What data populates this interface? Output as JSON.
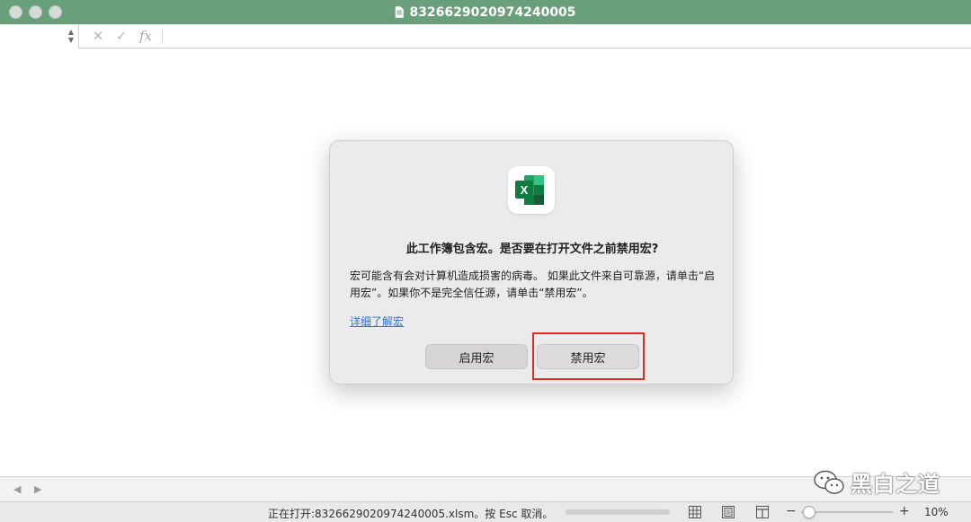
{
  "window": {
    "title": "8326629020974240005"
  },
  "colors": {
    "titlebar": "#69a07b",
    "excel_green": "#1d6f42",
    "link": "#2d6fd6",
    "highlight": "#e02a2a"
  },
  "formula_bar": {
    "name_box_value": "",
    "fx_label": "fx",
    "cancel_icon": "x-icon",
    "confirm_icon": "check-icon"
  },
  "dialog": {
    "app_icon_letter": "X",
    "title": "此工作簿包含宏。是否要在打开文件之前禁用宏?",
    "body": "宏可能含有会对计算机造成损害的病毒。 如果此文件来自可靠源，请单击“启用宏”。如果你不是完全信任源，请单击“禁用宏”。",
    "learn_more": "详细了解宏",
    "enable_button": "启用宏",
    "disable_button": "禁用宏"
  },
  "status_bar": {
    "message": "正在打开:8326629020974240005.xlsm。按 Esc 取消。",
    "progress": 0.0,
    "zoom_minus": "−",
    "zoom_plus": "+",
    "zoom_level": "10%"
  },
  "watermark": {
    "text": "黑白之道"
  }
}
